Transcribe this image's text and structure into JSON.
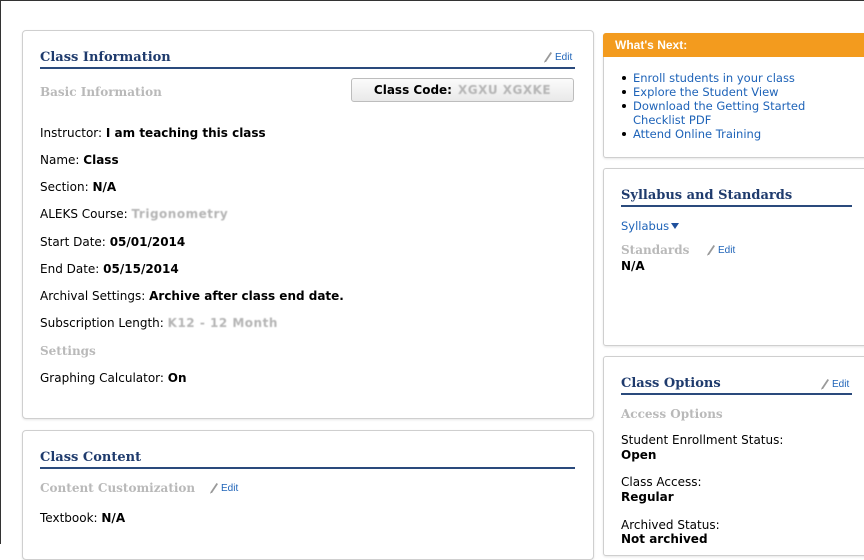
{
  "class_info": {
    "title": "Class Information",
    "edit_label": "Edit",
    "basic_label": "Basic Information",
    "class_code_label": "Class Code:",
    "class_code_value": "XGXU XGXKE",
    "instructor_label": "Instructor:",
    "instructor_value": "I am teaching this class",
    "name_label": "Name:",
    "name_value": "Class",
    "section_label": "Section:",
    "section_value": "N/A",
    "course_label": "ALEKS Course:",
    "course_value": "Trigonometry",
    "start_label": "Start Date:",
    "start_value": "05/01/2014",
    "end_label": "End Date:",
    "end_value": "05/15/2014",
    "archival_label": "Archival Settings:",
    "archival_value": "Archive after class end date.",
    "subscription_label": "Subscription Length:",
    "subscription_value": "K12 - 12 Month",
    "settings_label": "Settings",
    "calculator_label": "Graphing Calculator:",
    "calculator_value": "On"
  },
  "class_content": {
    "title": "Class Content",
    "customization_label": "Content Customization",
    "edit_label": "Edit",
    "textbook_label": "Textbook:",
    "textbook_value": "N/A"
  },
  "whats_next": {
    "title": "What's Next:",
    "items": [
      "Enroll students in your class",
      "Explore the Student View",
      "Download the Getting Started Checklist PDF",
      "Attend Online Training"
    ]
  },
  "syllabus": {
    "title": "Syllabus and Standards",
    "syllabus_link": "Syllabus",
    "standards_label": "Standards",
    "edit_label": "Edit",
    "standards_value": "N/A"
  },
  "class_options": {
    "title": "Class Options",
    "edit_label": "Edit",
    "access_label": "Access Options",
    "enrollment_label": "Student Enrollment Status:",
    "enrollment_value": "Open",
    "access_status_label": "Class Access:",
    "access_status_value": "Regular",
    "archived_label": "Archived Status:",
    "archived_value": "Not archived"
  },
  "colors": {
    "accent_orange": "#f39b1e",
    "title_navy": "#1f3b6d",
    "link_blue": "#1e63b8",
    "muted_gray": "#b9b9b9"
  }
}
